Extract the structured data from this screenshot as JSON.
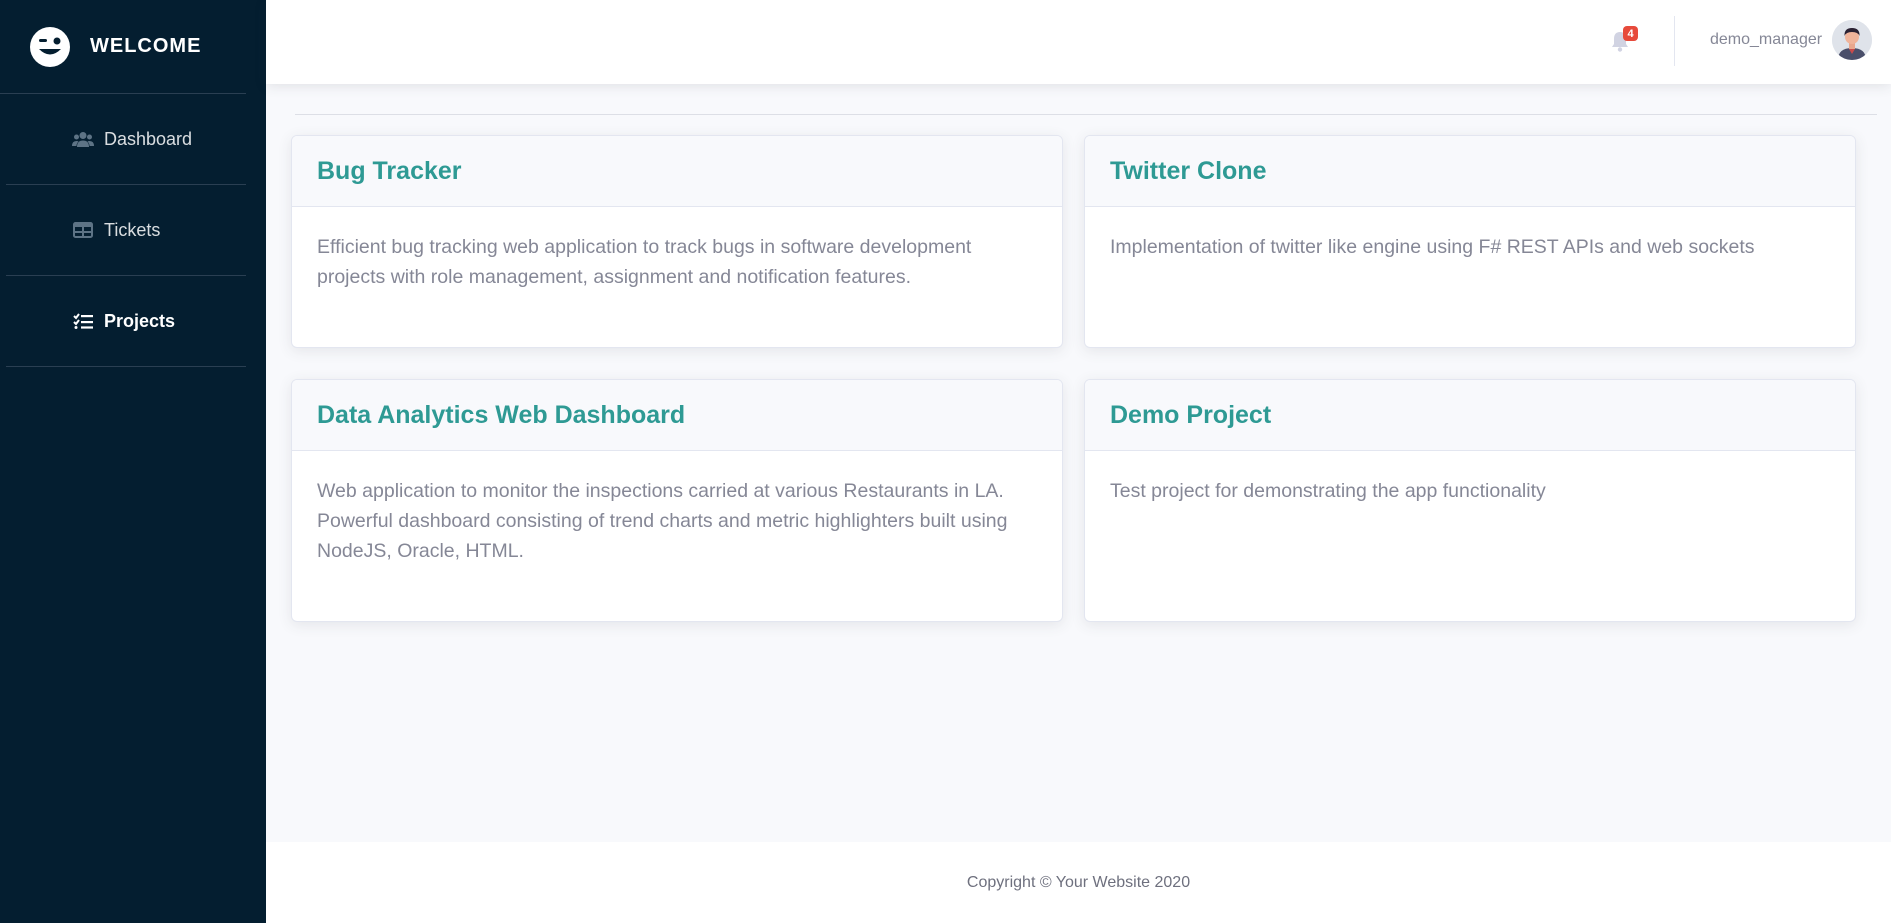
{
  "sidebar": {
    "brand": {
      "title": "WELCOME",
      "icon": "winking-face-icon"
    },
    "items": [
      {
        "label": "Dashboard",
        "icon": "users-icon",
        "active": false
      },
      {
        "label": "Tickets",
        "icon": "table-icon",
        "active": false
      },
      {
        "label": "Projects",
        "icon": "task-list-icon",
        "active": true
      }
    ]
  },
  "topbar": {
    "notifications": {
      "icon": "bell-icon",
      "count": "4"
    },
    "user": {
      "name": "demo_manager",
      "avatar": "user-avatar"
    }
  },
  "projects": [
    {
      "title": "Bug Tracker",
      "description": "Efficient bug tracking web application to track bugs in software development projects with role management, assignment and notification features."
    },
    {
      "title": "Twitter Clone",
      "description": "Implementation of twitter like engine using F# REST APIs and web sockets"
    },
    {
      "title": "Data Analytics Web Dashboard",
      "description": "Web application to monitor the inspections carried at various Restaurants in LA. Powerful dashboard consisting of trend charts and metric highlighters built using NodeJS, Oracle, HTML."
    },
    {
      "title": "Demo Project",
      "description": "Test project for demonstrating the app functionality"
    }
  ],
  "footer": {
    "copyright": "Copyright © Your Website 2020"
  },
  "colors": {
    "sidebar": "#041e30",
    "accent": "#2e9a94",
    "badge": "#e74a3b",
    "background": "#f8f9fc"
  }
}
